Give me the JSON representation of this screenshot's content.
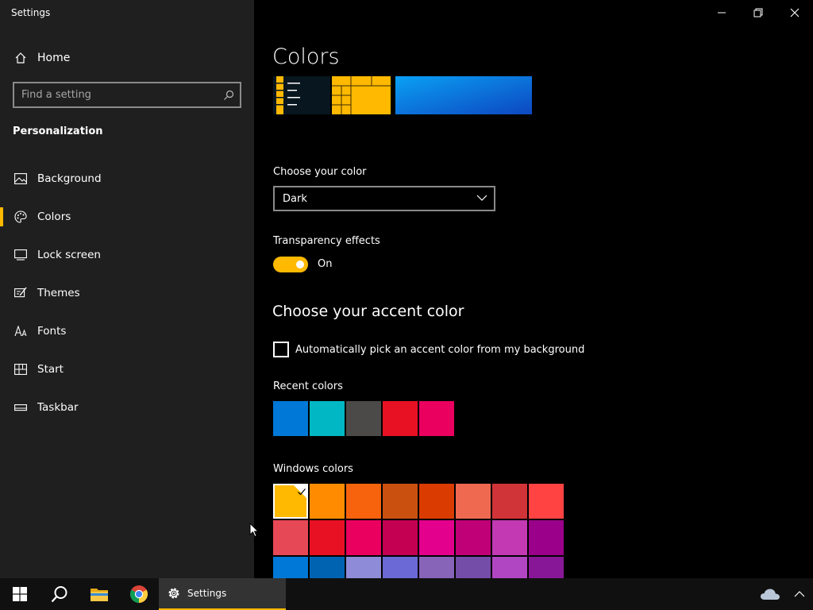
{
  "window": {
    "title": "Settings"
  },
  "sidebar": {
    "home_label": "Home",
    "search_placeholder": "Find a setting",
    "section_title": "Personalization",
    "items": [
      {
        "label": "Background",
        "icon": "image-icon"
      },
      {
        "label": "Colors",
        "icon": "palette-icon",
        "active": true
      },
      {
        "label": "Lock screen",
        "icon": "lock-screen-icon"
      },
      {
        "label": "Themes",
        "icon": "themes-icon"
      },
      {
        "label": "Fonts",
        "icon": "fonts-icon"
      },
      {
        "label": "Start",
        "icon": "start-icon"
      },
      {
        "label": "Taskbar",
        "icon": "taskbar-icon"
      }
    ]
  },
  "main": {
    "title": "Colors",
    "choose_color_label": "Choose your color",
    "choose_color_value": "Dark",
    "transparency_label": "Transparency effects",
    "transparency_state": "On",
    "accent_heading": "Choose your accent color",
    "auto_accent_label": "Automatically pick an accent color from my background",
    "recent_colors_label": "Recent colors",
    "recent_colors": [
      "#0078d7",
      "#00b7c3",
      "#4c4a48",
      "#e81123",
      "#ea005e"
    ],
    "windows_colors_label": "Windows colors",
    "windows_colors": [
      "#ffb900",
      "#ff8c00",
      "#f7630c",
      "#ca5010",
      "#da3b01",
      "#ef6950",
      "#d13438",
      "#ff4343",
      "#e74856",
      "#e81123",
      "#ea005e",
      "#c30052",
      "#e3008c",
      "#bf0077",
      "#c239b3",
      "#9a0089",
      "#0078d7",
      "#0063b1",
      "#8e8cd8",
      "#6b69d6",
      "#8764b8",
      "#744da9",
      "#b146c2",
      "#881798"
    ],
    "selected_color": "#ffb900"
  },
  "taskbar": {
    "active_app_label": "Settings",
    "accent": "#ffb900"
  }
}
